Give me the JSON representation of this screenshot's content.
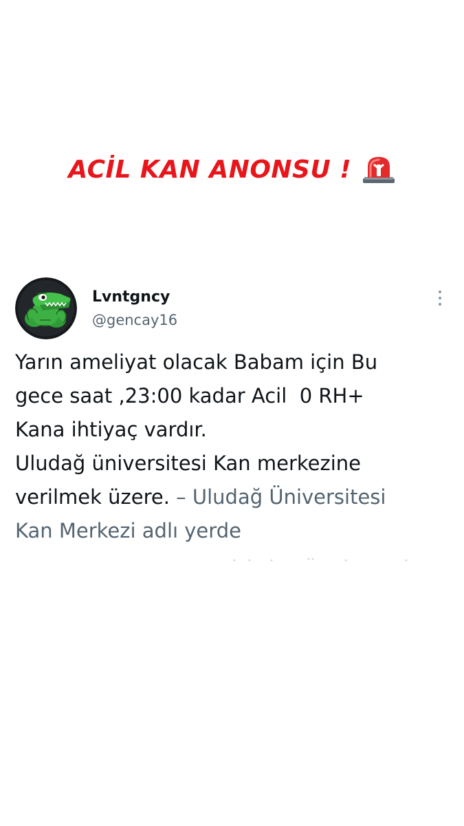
{
  "announcement": {
    "title": "ACİL KAN ANONSU !",
    "icon": "siren-icon",
    "title_color": "#e8151b"
  },
  "tweet": {
    "avatar_icon": "crocodile-avatar-icon",
    "display_name": "Lvntgncy",
    "handle": "@gencay16",
    "more_icon": "more-options-icon",
    "body_lines": [
      "Yarın ameliyat olacak Babam için Bu",
      "gece saat ,23:00 kadar Acil  0 RH+",
      "Kana ihtiyaç vardır.",
      "Uludağ üniversitesi Kan merkezine"
    ],
    "body_last_text": "verilmek üzere. ",
    "location_line_1": "– Uludağ Üniversitesi",
    "location_line_2": "Kan Merkezi adlı yerde",
    "colors": {
      "text": "#0f1419",
      "secondary": "#536471"
    }
  }
}
